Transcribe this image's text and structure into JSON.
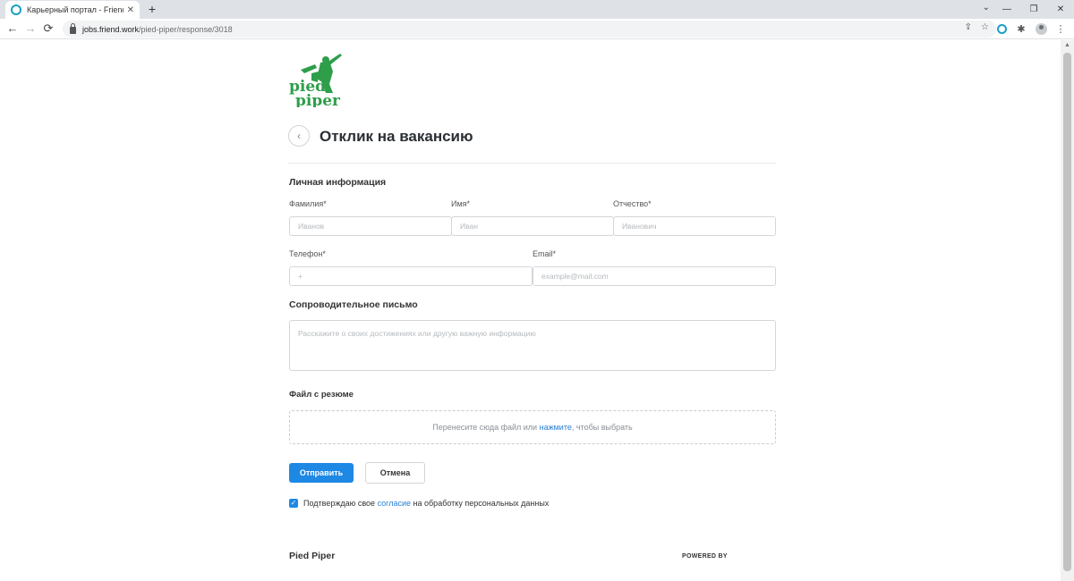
{
  "browser": {
    "tab_title": "Карьерный портал - FriendWork",
    "tab_close": "✕",
    "new_tab": "+",
    "url_host": "jobs.friend.work",
    "url_path": "/pied-piper/response/3018",
    "back": "←",
    "forward": "→",
    "reload": "⟳",
    "tab_dropdown": "⌄",
    "minimize": "—",
    "restore": "❐",
    "close": "✕",
    "share_icon": "⇪",
    "star_icon": "☆",
    "puzzle_icon": "✱",
    "menu_icon": "⋮",
    "accent_color": "#19a0c4"
  },
  "page": {
    "logo_text_line1": "pied",
    "logo_text_line2": "piper",
    "logo_color": "#2e9e4a",
    "back_icon": "‹",
    "title": "Отклик на вакансию"
  },
  "personal": {
    "section_title": "Личная информация",
    "last_name": {
      "label": "Фамилия*",
      "placeholder": "Иванов"
    },
    "first_name": {
      "label": "Имя*",
      "placeholder": "Иван"
    },
    "middle_name": {
      "label": "Отчество*",
      "placeholder": "Иванович"
    },
    "phone": {
      "label": "Телефон*",
      "placeholder": "+"
    },
    "email": {
      "label": "Email*",
      "placeholder": "example@mail.com"
    }
  },
  "cover_letter": {
    "section_title": "Сопроводительное письмо",
    "placeholder": "Расскажите о своих достижениях или другую важную информацию"
  },
  "resume": {
    "section_title": "Файл с резюме",
    "drop_text_before": "Перенесите сюда файл или ",
    "drop_link": "нажмите",
    "drop_text_after": ", чтобы выбрать"
  },
  "actions": {
    "submit_label": "Отправить",
    "cancel_label": "Отмена",
    "primary_color": "#1e88e5"
  },
  "consent": {
    "checked": true,
    "check_mark": "✓",
    "text_before": "Подтверждаю свое ",
    "link": "согласие",
    "text_after": " на обработку персональных данных"
  },
  "footer": {
    "company_name": "Pied Piper",
    "powered_by": "POWERED BY"
  }
}
